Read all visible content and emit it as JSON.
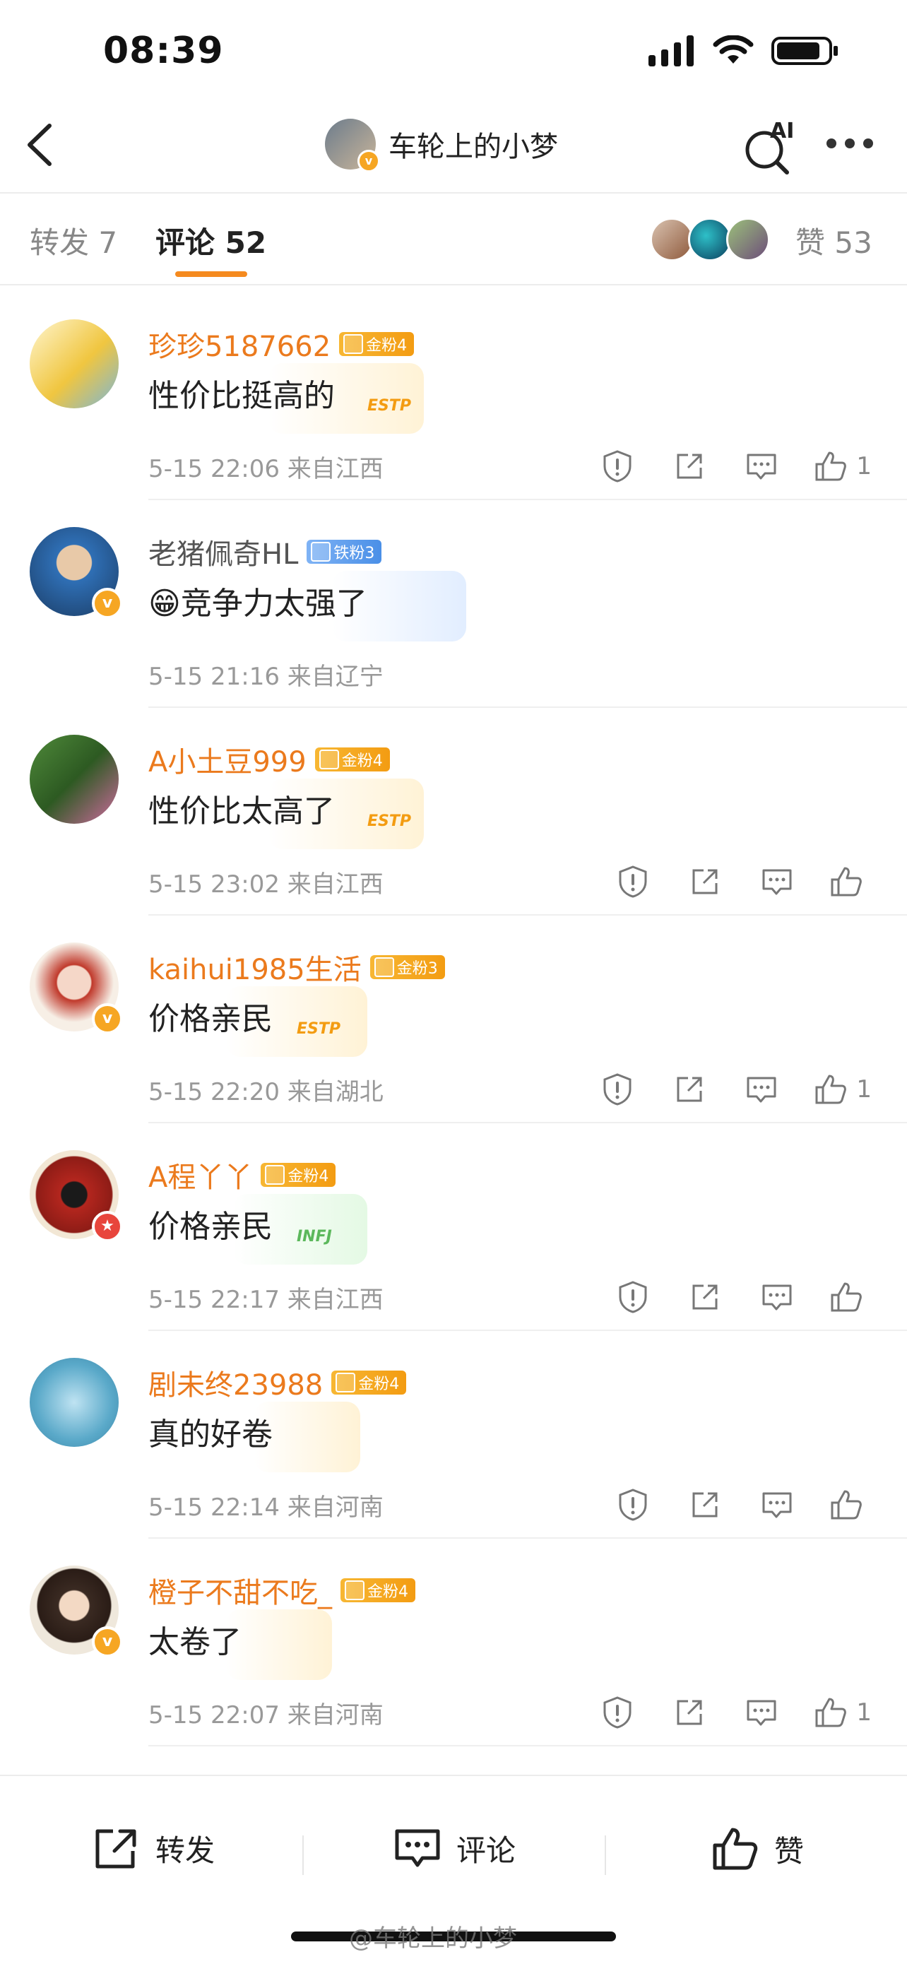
{
  "status_bar": {
    "time": "08:39"
  },
  "nav": {
    "title": "车轮上的小梦",
    "ai_label": "AI",
    "avatar_badge": "v"
  },
  "tabs": [
    {
      "label": "转发 7"
    },
    {
      "label": "评论 52"
    }
  ],
  "likes": {
    "label": "赞 53"
  },
  "comments": [
    {
      "name": "珍珍5187662",
      "badge": "金粉4",
      "badge_type": "gold",
      "text": "性价比挺高的",
      "deco": "ESTP",
      "meta": "5-15 22:06 来自江西",
      "like_count": "1",
      "verified": false
    },
    {
      "name": "老猪佩奇HL",
      "badge": "铁粉3",
      "badge_type": "iron",
      "text": "😁竞争力太强了",
      "deco": "",
      "meta": "5-15 21:16 来自辽宁",
      "like_count": "",
      "verified": true
    },
    {
      "name": "A小土豆999",
      "badge": "金粉4",
      "badge_type": "gold",
      "text": "性价比太高了",
      "deco": "ESTP",
      "meta": "5-15 23:02 来自江西",
      "like_count": "",
      "verified": false
    },
    {
      "name": "kaihui1985生活",
      "badge": "金粉3",
      "badge_type": "gold",
      "text": "价格亲民",
      "deco": "ESTP",
      "meta": "5-15 22:20 来自湖北",
      "like_count": "1",
      "verified": true
    },
    {
      "name": "A程丫丫",
      "badge": "金粉4",
      "badge_type": "gold",
      "text": "价格亲民",
      "deco": "INFJ",
      "meta": "5-15 22:17 来自江西",
      "like_count": "",
      "verified": true
    },
    {
      "name": "剧未终23988",
      "badge": "金粉4",
      "badge_type": "gold",
      "text": "真的好卷",
      "deco": "",
      "meta": "5-15 22:14 来自河南",
      "like_count": "",
      "verified": false
    },
    {
      "name": "橙子不甜不吃_",
      "badge": "金粉4",
      "badge_type": "gold",
      "text": "太卷了",
      "deco": "",
      "meta": "5-15 22:07 来自河南",
      "like_count": "1",
      "verified": true
    }
  ],
  "bottom_bar": {
    "repost_label": "转发",
    "comment_label": "评论",
    "like_label": "赞"
  },
  "watermark": "@车轮上的小梦",
  "colors": {
    "accent": "#f58a1f",
    "name": "#eb7a1d",
    "gold_badge": "#f39c12",
    "iron_badge": "#4a8fe7"
  }
}
